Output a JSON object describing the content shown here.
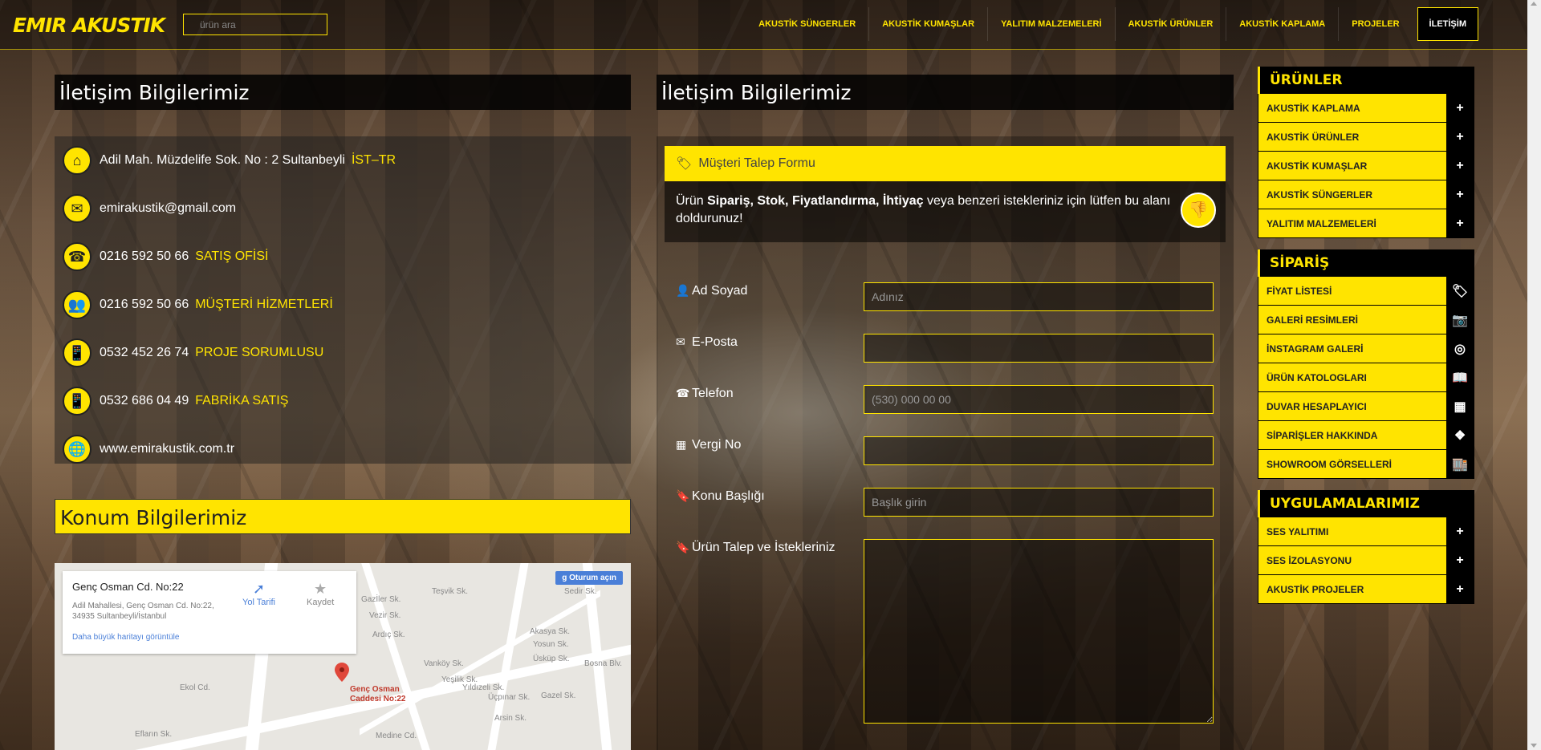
{
  "brand": {
    "logo_text": "EMIR AKUSTIK",
    "accent": "#ffe400"
  },
  "search": {
    "placeholder": "ürün ara"
  },
  "nav": [
    "AKUSTİK SÜNGERLER",
    "AKUSTİK KUMAŞLAR",
    "YALITIM MALZEMELERİ",
    "AKUSTİK ÜRÜNLER",
    "AKUSTİK KAPLAMA",
    "PROJELER",
    "İLETİŞİM"
  ],
  "contact": {
    "title": "İletişim Bilgilerimiz",
    "rows": [
      {
        "icon": "home-icon",
        "text": "Adil Mah. Müzdelife Sok. No : 2  Sultanbeyli",
        "sub": "İST–TR"
      },
      {
        "icon": "mail-icon",
        "text": "emirakustik@gmail.com",
        "sub": ""
      },
      {
        "icon": "phone-icon",
        "text": " 0216 592 50 66",
        "sub": "SATIŞ OFİSİ"
      },
      {
        "icon": "users-icon",
        "text": "0216 592 50 66",
        "sub": "MÜŞTERİ HİZMETLERİ"
      },
      {
        "icon": "mobile-icon",
        "text": "0532 452 26 74",
        "sub": "PROJE SORUMLUSU"
      },
      {
        "icon": "mobile-icon",
        "text": "0532 686 04 49",
        "sub": "FABRİKA SATIŞ"
      },
      {
        "icon": "globe-icon",
        "text": "www.emirakustik.com.tr",
        "sub": ""
      }
    ]
  },
  "location": {
    "title": "Konum Bilgilerimiz"
  },
  "map": {
    "card_title": "Genç Osman Cd. No:22",
    "card_address": "Adil Mahallesi, Genç Osman Cd. No:22, 34935 Sultanbeyli/İstanbul",
    "card_link": "Daha büyük haritayı görüntüle",
    "directions": "Yol Tarifi",
    "save": "Kaydet",
    "signin": "Oturum açın",
    "pin_label": "Genç Osman Caddesi No:22",
    "street_labels": [
      "Gazİler Sk.",
      "Vezir Sk.",
      "Teşvik Sk.",
      "Ardıç Sk.",
      "Sedir Sk.",
      "Akasya Sk.",
      "Yosun Sk.",
      "Üsküp Sk.",
      "Vanköy Sk.",
      "Yeşilik Sk.",
      "Yıldızeli Sk.",
      "Ekol Cd.",
      "Efların Sk.",
      "Medine Cd.",
      "Üçpınar Sk.",
      "Arsin Sk.",
      "Gazel Sk.",
      "Bosna Blv."
    ]
  },
  "form": {
    "section_title": "İletişim Bilgilerimiz",
    "head": "Müşteri Talep Formu",
    "info_prefix": "Ürün ",
    "info_bold": "Sipariş, Stok, Fiyatlandırma, İhtiyaç",
    "info_suffix": " veya benzeri istekleriniz için lütfen bu alanı doldurunuz!",
    "fields": [
      {
        "label": "Ad Soyad",
        "placeholder": "Adınız",
        "icon": "user-icon"
      },
      {
        "label": "E-Posta",
        "placeholder": "",
        "icon": "envelope-icon"
      },
      {
        "label": "Telefon",
        "placeholder": "(530) 000 00 00",
        "icon": "phone-icon"
      },
      {
        "label": "Vergi No",
        "placeholder": "",
        "icon": "table-icon"
      },
      {
        "label": "Konu Başlığı",
        "placeholder": "Başlık girin",
        "icon": "bookmark-icon"
      },
      {
        "label": "Ürün Talep ve İstekleriniz",
        "placeholder": "",
        "icon": "bookmark-icon"
      }
    ]
  },
  "sidebar": {
    "sections": [
      {
        "title": "ÜRÜNLER",
        "items": [
          {
            "label": "AKUSTİK KAPLAMA",
            "icon": "plus-icon"
          },
          {
            "label": "AKUSTİK ÜRÜNLER",
            "icon": "plus-icon"
          },
          {
            "label": "AKUSTİK KUMAŞLAR",
            "icon": "plus-icon"
          },
          {
            "label": "AKUSTİK SÜNGERLER",
            "icon": "plus-icon"
          },
          {
            "label": "YALITIM MALZEMELERİ",
            "icon": "plus-icon"
          }
        ]
      },
      {
        "title": "SİPARİŞ",
        "items": [
          {
            "label": "FİYAT LİSTESİ",
            "icon": "tags-icon"
          },
          {
            "label": "GALERİ RESİMLERİ",
            "icon": "camera-icon"
          },
          {
            "label": "İNSTAGRAM GALERİ",
            "icon": "instagram-icon"
          },
          {
            "label": "ÜRÜN KATOLOGLARI",
            "icon": "book-icon"
          },
          {
            "label": "DUVAR HESAPLAYICI",
            "icon": "calculator-icon"
          },
          {
            "label": "SİPARİŞLER HAKKINDA",
            "icon": "dropbox-icon"
          },
          {
            "label": "SHOWROOM GÖRSELLERİ",
            "icon": "store-icon"
          }
        ]
      },
      {
        "title": "UYGULAMALARIMIZ",
        "items": [
          {
            "label": "SES YALITIMI",
            "icon": "plus-icon"
          },
          {
            "label": "SES İZOLASYONU",
            "icon": "plus-icon"
          },
          {
            "label": "AKUSTİK PROJELER",
            "icon": "plus-icon"
          }
        ]
      }
    ]
  }
}
